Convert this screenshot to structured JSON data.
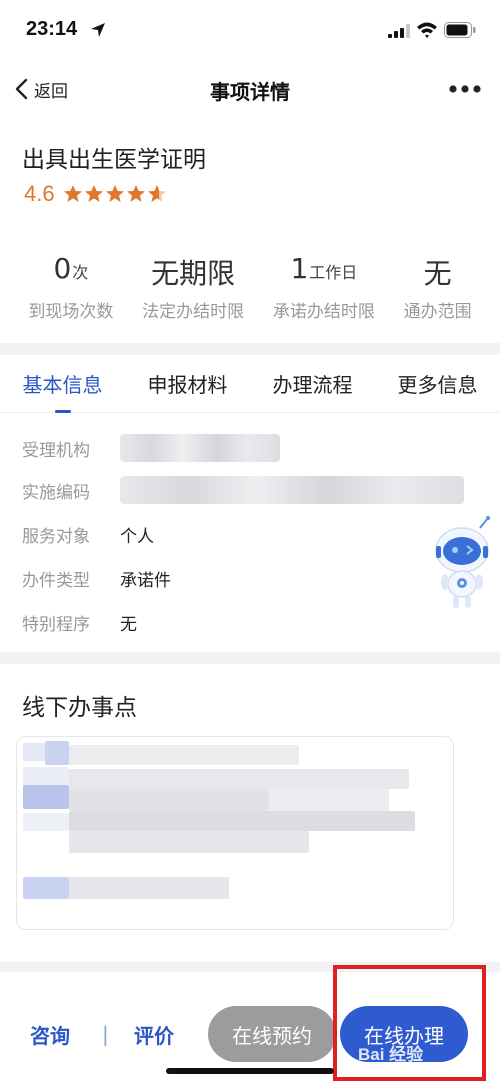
{
  "status_bar": {
    "time": "23:14"
  },
  "nav": {
    "back_label": "返回",
    "title": "事项详情"
  },
  "item": {
    "title": "出具出生医学证明",
    "rating": "4.6",
    "stars_filled": 4.6
  },
  "stats": [
    {
      "value": "0",
      "unit": "次",
      "label": "到现场次数"
    },
    {
      "value": "无期限",
      "unit": "",
      "label": "法定办结时限"
    },
    {
      "value": "1",
      "unit": "工作日",
      "label": "承诺办结时限"
    },
    {
      "value": "无",
      "unit": "",
      "label": "通办范围"
    }
  ],
  "tabs": [
    {
      "label": "基本信息",
      "active": true
    },
    {
      "label": "申报材料",
      "active": false
    },
    {
      "label": "办理流程",
      "active": false
    },
    {
      "label": "更多信息",
      "active": false
    }
  ],
  "basic_info": [
    {
      "label": "受理机构",
      "value": ""
    },
    {
      "label": "实施编码",
      "value": ""
    },
    {
      "label": "服务对象",
      "value": "个人"
    },
    {
      "label": "办件类型",
      "value": "承诺件"
    },
    {
      "label": "特别程序",
      "value": "无"
    }
  ],
  "offline": {
    "title": "线下办事点"
  },
  "bottom": {
    "consult_label": "咨询",
    "separator": "|",
    "review_label": "评价",
    "appointment_label": "在线预约",
    "online_label": "在线办理"
  },
  "watermark": "Bai 经验",
  "colors": {
    "accent": "#2a56c6",
    "rating": "#e0772b",
    "highlight": "#e02020"
  }
}
